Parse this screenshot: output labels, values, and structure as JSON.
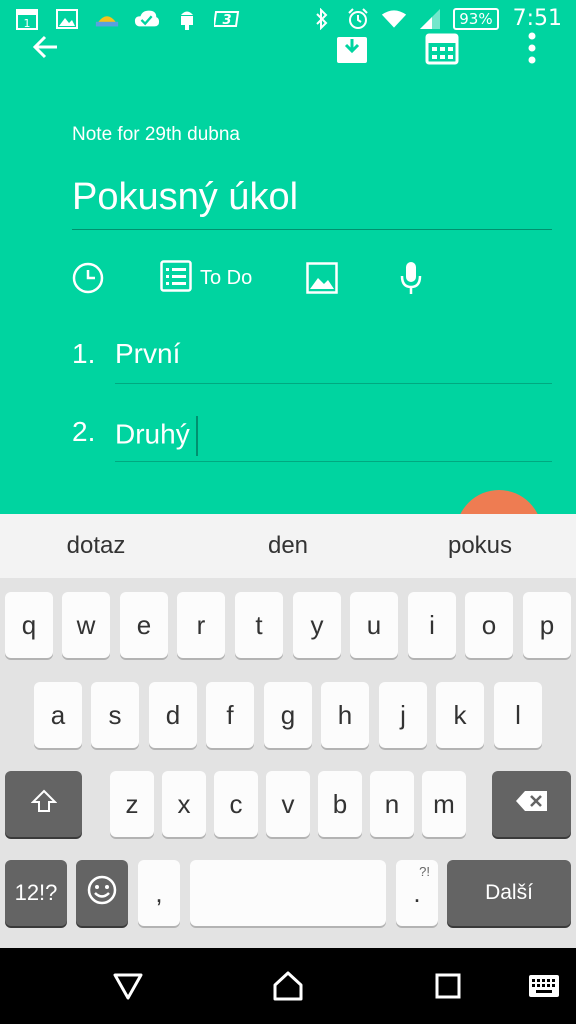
{
  "status_bar": {
    "calendar_day": "1",
    "battery": "93%",
    "time": "7:51",
    "icons": [
      "calendar-icon",
      "gallery-icon",
      "weather-icon",
      "sync-done-icon",
      "android-debug-icon",
      "app3-icon",
      "bluetooth-icon",
      "alarm-icon",
      "wifi-icon",
      "signal-icon",
      "battery-icon"
    ]
  },
  "toolbar": {
    "icons": [
      "back-arrow-icon",
      "archive-icon",
      "calendar-icon",
      "overflow-menu-icon"
    ]
  },
  "note": {
    "date_caption": "Note for 29th dubna",
    "title": "Pokusný úkol"
  },
  "tools": {
    "reminder_icon": "clock-icon",
    "todo_label": "To Do",
    "image_icon": "image-icon",
    "audio_icon": "microphone-icon"
  },
  "list": [
    {
      "number": "1.",
      "text": "První"
    },
    {
      "number": "2.",
      "text": "Druhý"
    }
  ],
  "keyboard": {
    "suggestions": [
      "dotaz",
      "den",
      "pokus"
    ],
    "row1": [
      "q",
      "w",
      "e",
      "r",
      "t",
      "y",
      "u",
      "i",
      "o",
      "p"
    ],
    "row2": [
      "a",
      "s",
      "d",
      "f",
      "g",
      "h",
      "j",
      "k",
      "l"
    ],
    "row3": [
      "z",
      "x",
      "c",
      "v",
      "b",
      "n",
      "m"
    ],
    "symbols_label": "12!?",
    "comma_label": ",",
    "period_label": ".",
    "period_alt": "?!",
    "action_label": "Další"
  },
  "colors": {
    "accent": "#00D4A0",
    "fab": "#EE7C52"
  }
}
